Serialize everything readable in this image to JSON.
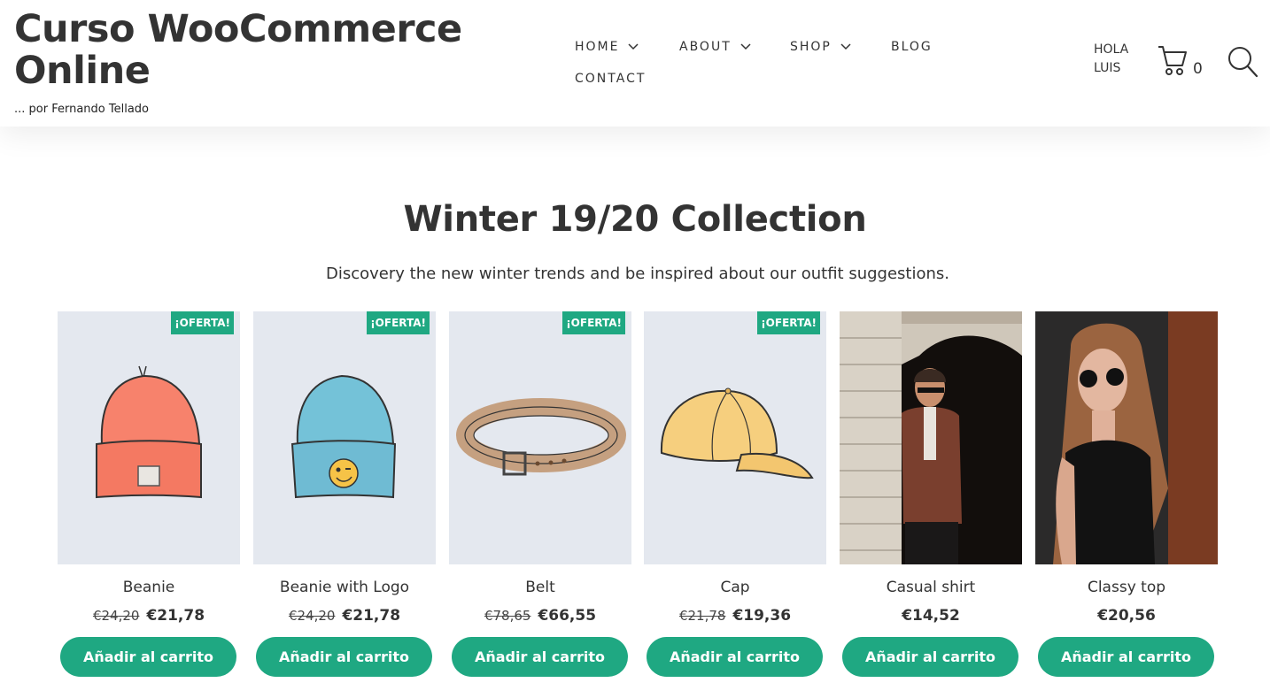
{
  "header": {
    "site_title": "Curso WooCommerce Online",
    "tagline": "... por Fernando Tellado",
    "nav": [
      {
        "label": "HOME"
      },
      {
        "label": "ABOUT"
      },
      {
        "label": "SHOP"
      },
      {
        "label": "BLOG"
      },
      {
        "label": "CONTACT"
      }
    ],
    "greeting_line1": "HOLA",
    "greeting_line2": "LUIS",
    "cart_count": "0",
    "icons": {
      "cart": "cart-icon",
      "search": "search-icon",
      "dropdown": "chevron-down-icon"
    }
  },
  "main": {
    "heading": "Winter 19/20 Collection",
    "subheading": "Discovery the new winter trends and be inspired about our outfit suggestions."
  },
  "colors": {
    "accent": "#1fa882",
    "product_bg": "#e4e8ef",
    "text": "#333333"
  },
  "products": [
    {
      "name": "Beanie",
      "badge": "¡OFERTA!",
      "old_price": "€24,20",
      "price": "€21,78",
      "button": "Añadir al carrito"
    },
    {
      "name": "Beanie with Logo",
      "badge": "¡OFERTA!",
      "old_price": "€24,20",
      "price": "€21,78",
      "button": "Añadir al carrito"
    },
    {
      "name": "Belt",
      "badge": "¡OFERTA!",
      "old_price": "€78,65",
      "price": "€66,55",
      "button": "Añadir al carrito"
    },
    {
      "name": "Cap",
      "badge": "¡OFERTA!",
      "old_price": "€21,78",
      "price": "€19,36",
      "button": "Añadir al carrito"
    },
    {
      "name": "Casual shirt",
      "price": "€14,52",
      "button": "Añadir al carrito"
    },
    {
      "name": "Classy top",
      "price": "€20,56",
      "button": "Añadir al carrito"
    }
  ]
}
